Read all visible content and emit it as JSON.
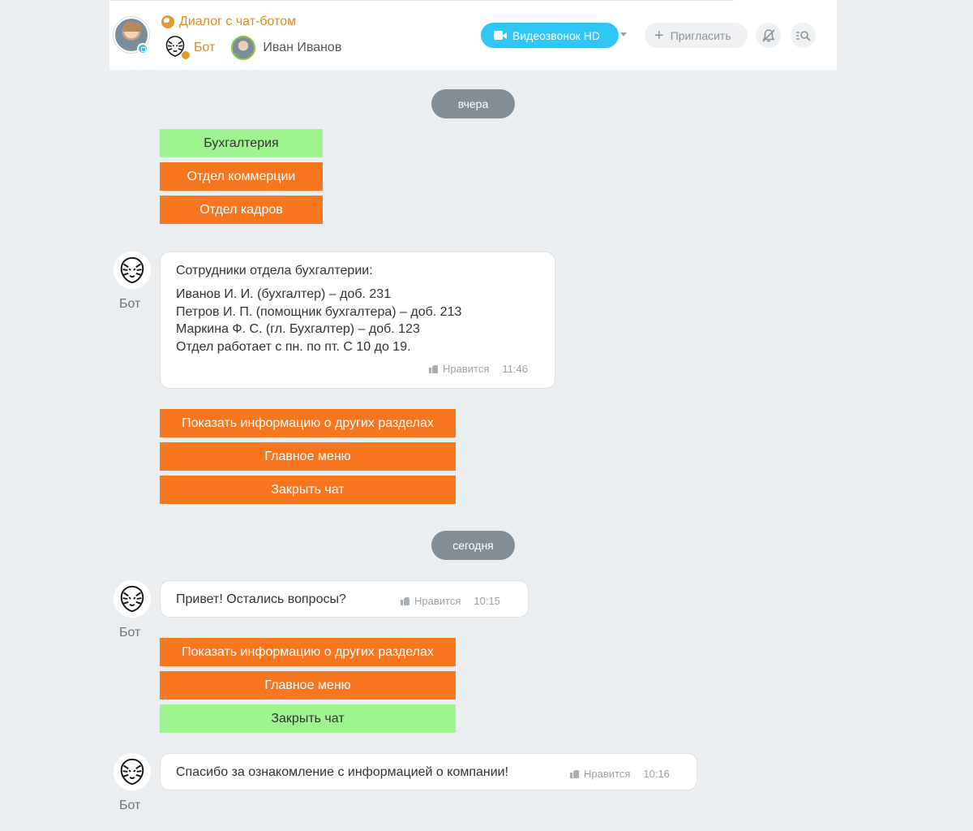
{
  "header": {
    "chat_title": "Диалог с чат-ботом",
    "member_bot": "Бот",
    "member_user": "Иван Иванов",
    "video_call_label": "Видеозвонок HD",
    "invite_label": "Пригласить"
  },
  "dates": {
    "yesterday": "вчера",
    "today": "сегодня"
  },
  "keyboards": {
    "first": [
      "Бухгалтерия",
      "Отдел коммерции",
      "Отдел кадров"
    ],
    "second": [
      "Показать информацию о других разделах",
      "Главное меню",
      "Закрыть чат"
    ],
    "third": [
      "Показать информацию о других разделах",
      "Главное меню",
      "Закрыть чат"
    ]
  },
  "bot_name": "Бот",
  "messages": {
    "m1": {
      "title": "Сотрудники отдела бухгалтерии:",
      "lines": [
        "Иванов И. И. (бухгалтер) – доб. 231",
        "Петров И. П. (помощник бухгалтера) – доб. 213",
        "Маркина Ф. С. (гл. Бухгалтер) – доб. 123",
        "Отдел работает с пн. по пт. С 10 до 19."
      ],
      "like": "Нравится",
      "time": "11:46"
    },
    "m2": {
      "text": "Привет! Остались вопросы?",
      "like": "Нравится",
      "time": "10:15"
    },
    "m3": {
      "text": "Спасибо за ознакомление с информацией о компании!",
      "like": "Нравится",
      "time": "10:16"
    }
  },
  "colors": {
    "accent_orange": "#f7761f",
    "selected_green": "#9ef58f",
    "video_blue": "#2fc6f6"
  }
}
